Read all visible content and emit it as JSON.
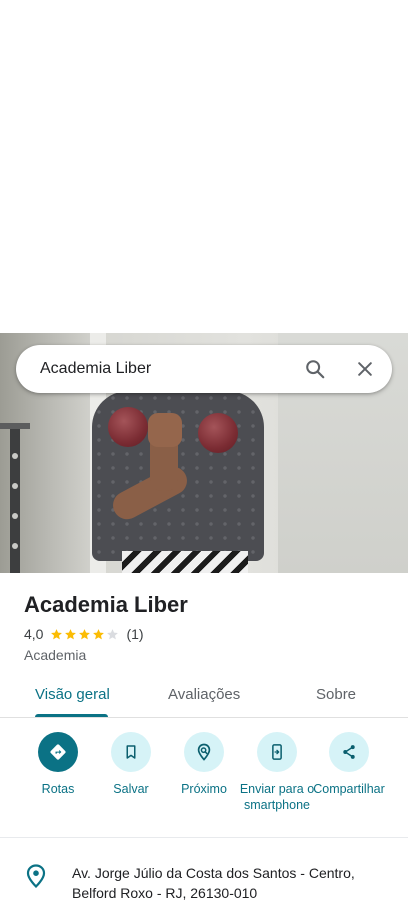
{
  "search": {
    "query": "Academia Liber"
  },
  "place": {
    "name": "Academia Liber",
    "rating": "4,0",
    "rating_stars": 4,
    "rating_max": 5,
    "review_count": "(1)",
    "category": "Academia"
  },
  "tabs": [
    {
      "label": "Visão geral",
      "active": true
    },
    {
      "label": "Avaliações",
      "active": false
    },
    {
      "label": "Sobre",
      "active": false
    }
  ],
  "actions": [
    {
      "label": "Rotas",
      "icon": "directions-icon"
    },
    {
      "label": "Salvar",
      "icon": "bookmark-icon"
    },
    {
      "label": "Próximo",
      "icon": "nearby-icon"
    },
    {
      "label": "Enviar para o smartphone",
      "icon": "send-to-phone-icon"
    },
    {
      "label": "Compartilhar",
      "icon": "share-icon"
    }
  ],
  "address": {
    "line": "Av. Jorge Júlio da Costa dos Santos - Centro, Belford Roxo - RJ, 26130-010"
  },
  "colors": {
    "accent": "#0b7285",
    "action_bg": "#d6f3f7",
    "star": "#fbbc04",
    "star_empty": "#dadce0"
  }
}
